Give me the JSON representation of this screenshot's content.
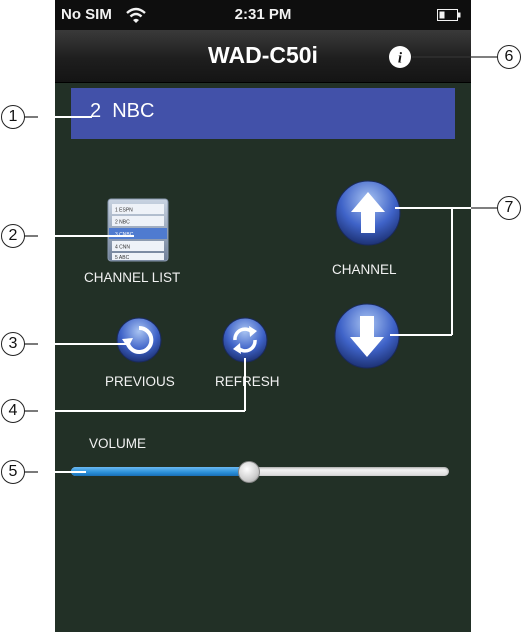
{
  "status_bar": {
    "carrier": "No SIM",
    "time": "2:31 PM",
    "wifi_icon": "wifi-icon",
    "battery_icon": "battery-icon"
  },
  "nav": {
    "title": "WAD-C50i",
    "info_icon": "info-icon"
  },
  "channel_display": {
    "text": "2  NBC",
    "color": "#4251a9"
  },
  "channel_list": {
    "label": "CHANNEL LIST",
    "thumbnail_rows": [
      "1 ESPN",
      "2 NBC",
      "3 CNBC",
      "4 CNN",
      "5 ABC"
    ]
  },
  "channel": {
    "label": "CHANNEL",
    "up_icon": "arrow-up-icon",
    "down_icon": "arrow-down-icon"
  },
  "previous": {
    "label": "PREVIOUS",
    "icon": "previous-icon"
  },
  "refresh": {
    "label": "REFRESH",
    "icon": "refresh-icon"
  },
  "volume": {
    "label": "VOLUME",
    "level": 0.47,
    "fill_color": "#2a8fd8"
  },
  "callouts": [
    "1",
    "2",
    "3",
    "4",
    "5",
    "6",
    "7"
  ],
  "colors": {
    "background": "#223026",
    "nav_bar": "#1e1e1e",
    "button_blue": "#3f63c8"
  }
}
